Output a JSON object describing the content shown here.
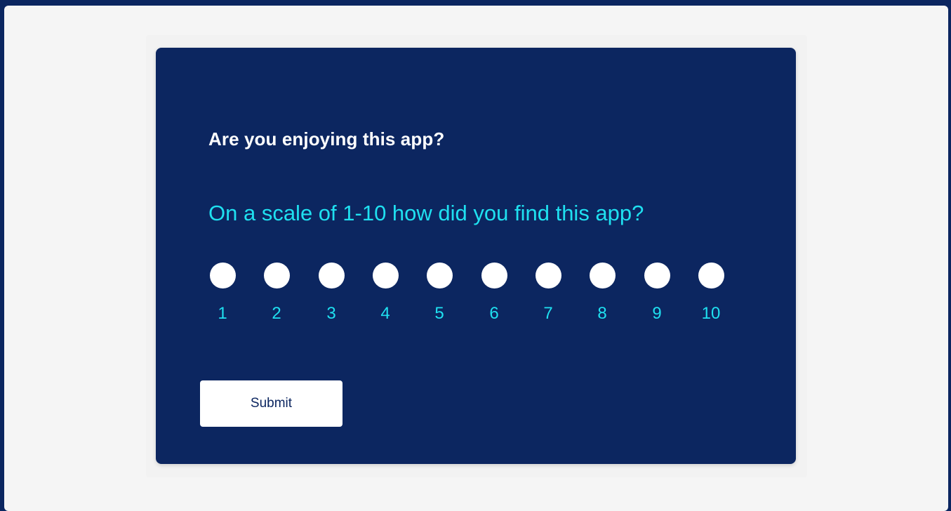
{
  "survey": {
    "heading": "Are you enjoying this app?",
    "question": "On a scale of 1-10 how did you find this app?",
    "options": [
      "1",
      "2",
      "3",
      "4",
      "5",
      "6",
      "7",
      "8",
      "9",
      "10"
    ],
    "submit_label": "Submit"
  },
  "colors": {
    "page_border": "#0b2660",
    "background": "#f5f5f5",
    "card": "#0c2660",
    "heading_text": "#ffffff",
    "accent_text": "#1fe0f0",
    "radio": "#ffffff",
    "button_bg": "#ffffff",
    "button_text": "#0c2660"
  }
}
